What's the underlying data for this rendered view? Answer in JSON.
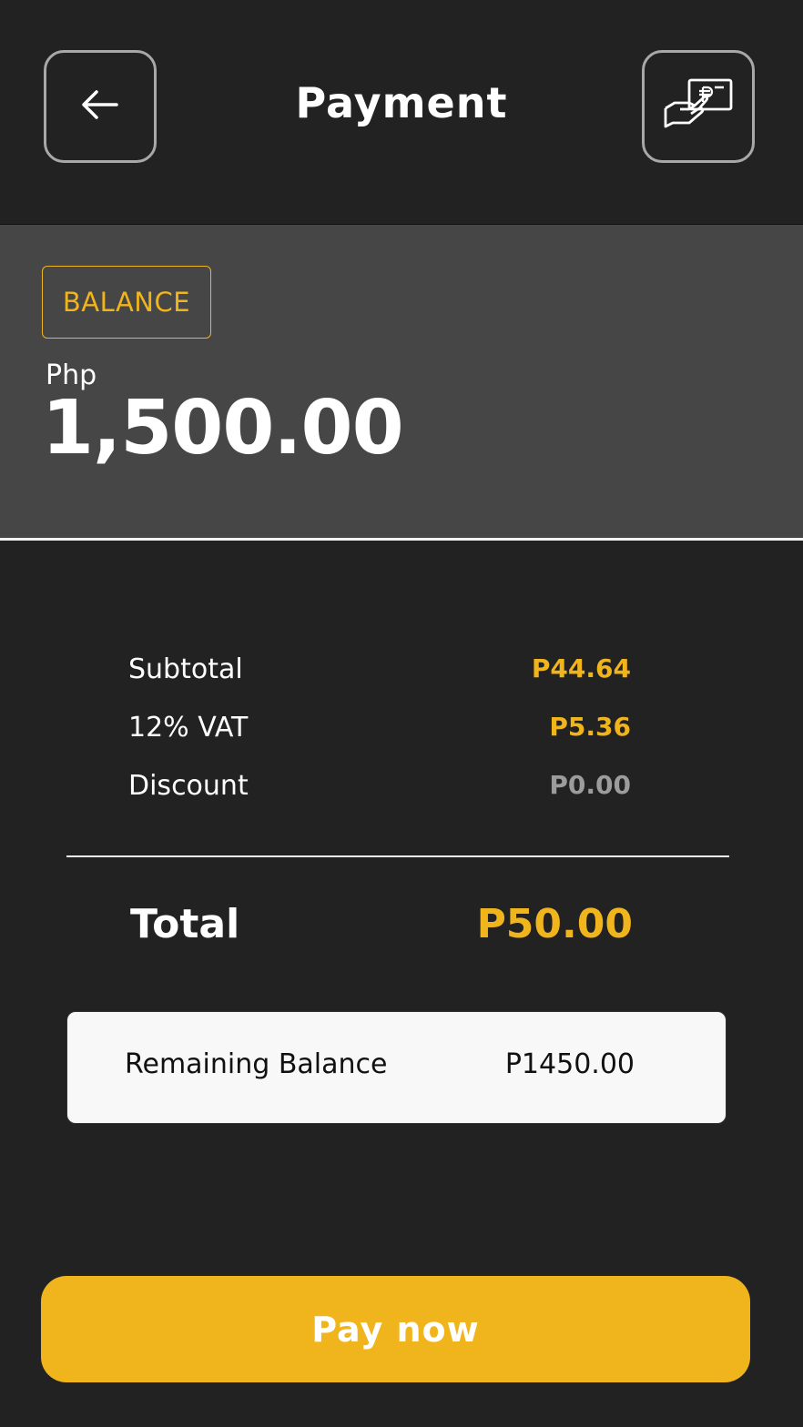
{
  "header": {
    "title": "Payment",
    "back_icon": "arrow-left-icon",
    "payment_icon": "hand-with-cash-icon"
  },
  "balance": {
    "tag": "BALANCE",
    "currency": "Php",
    "amount": "1,500.00"
  },
  "summary": {
    "subtotal_label": "Subtotal",
    "subtotal_value": "P44.64",
    "vat_label": "12% VAT",
    "vat_value": "P5.36",
    "discount_label": "Discount",
    "discount_value": "P0.00",
    "total_label": "Total",
    "total_value": "P50.00"
  },
  "remaining": {
    "label": "Remaining Balance",
    "value": "P1450.00"
  },
  "pay_button": {
    "label": "Pay now"
  },
  "colors": {
    "background": "#222222",
    "panel": "#464646",
    "accent": "#f0b41c",
    "muted": "#9c9c9c"
  }
}
